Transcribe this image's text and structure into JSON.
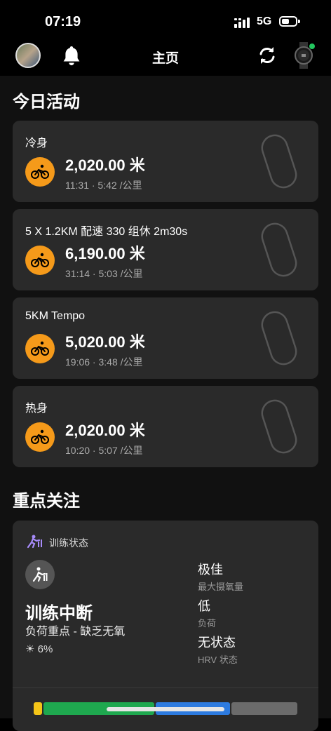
{
  "status_bar": {
    "time": "07:19",
    "network": "5G",
    "battery_level": 0.4
  },
  "nav": {
    "title": "主页",
    "avatar": "avatar-icon",
    "bell": "bell-icon",
    "sync": "sync-icon",
    "watch": "watch-icon",
    "connected_color": "#22c55e"
  },
  "today": {
    "title": "今日活动",
    "activities": [
      {
        "name": "冷身",
        "distance": "2,020.00 米",
        "meta": "11:31 · 5:42 /公里"
      },
      {
        "name": "5 X 1.2KM 配速 330 组休 2m30s",
        "distance": "6,190.00 米",
        "meta": "31:14 · 5:03 /公里"
      },
      {
        "name": "5KM Tempo",
        "distance": "5,020.00 米",
        "meta": "19:06 · 3:48 /公里"
      },
      {
        "name": "热身",
        "distance": "2,020.00 米",
        "meta": "10:20 · 5:07 /公里"
      }
    ],
    "activity_icon": "cycling-icon",
    "accent": "#f59a1a"
  },
  "focus": {
    "title": "重点关注",
    "card_title": "训练状态",
    "status": "训练中断",
    "load_focus": "负荷重点 - 缺乏无氧",
    "sun_value": "6%",
    "metrics": [
      {
        "value": "极佳",
        "label": "最大摄氧量"
      },
      {
        "value": "低",
        "label": "负荷"
      },
      {
        "value": "无状态",
        "label": "HRV 状态"
      }
    ],
    "bar_colors": [
      "#f5c518",
      "#1fa84f",
      "#2d7be0",
      "#6b6b6b"
    ]
  }
}
